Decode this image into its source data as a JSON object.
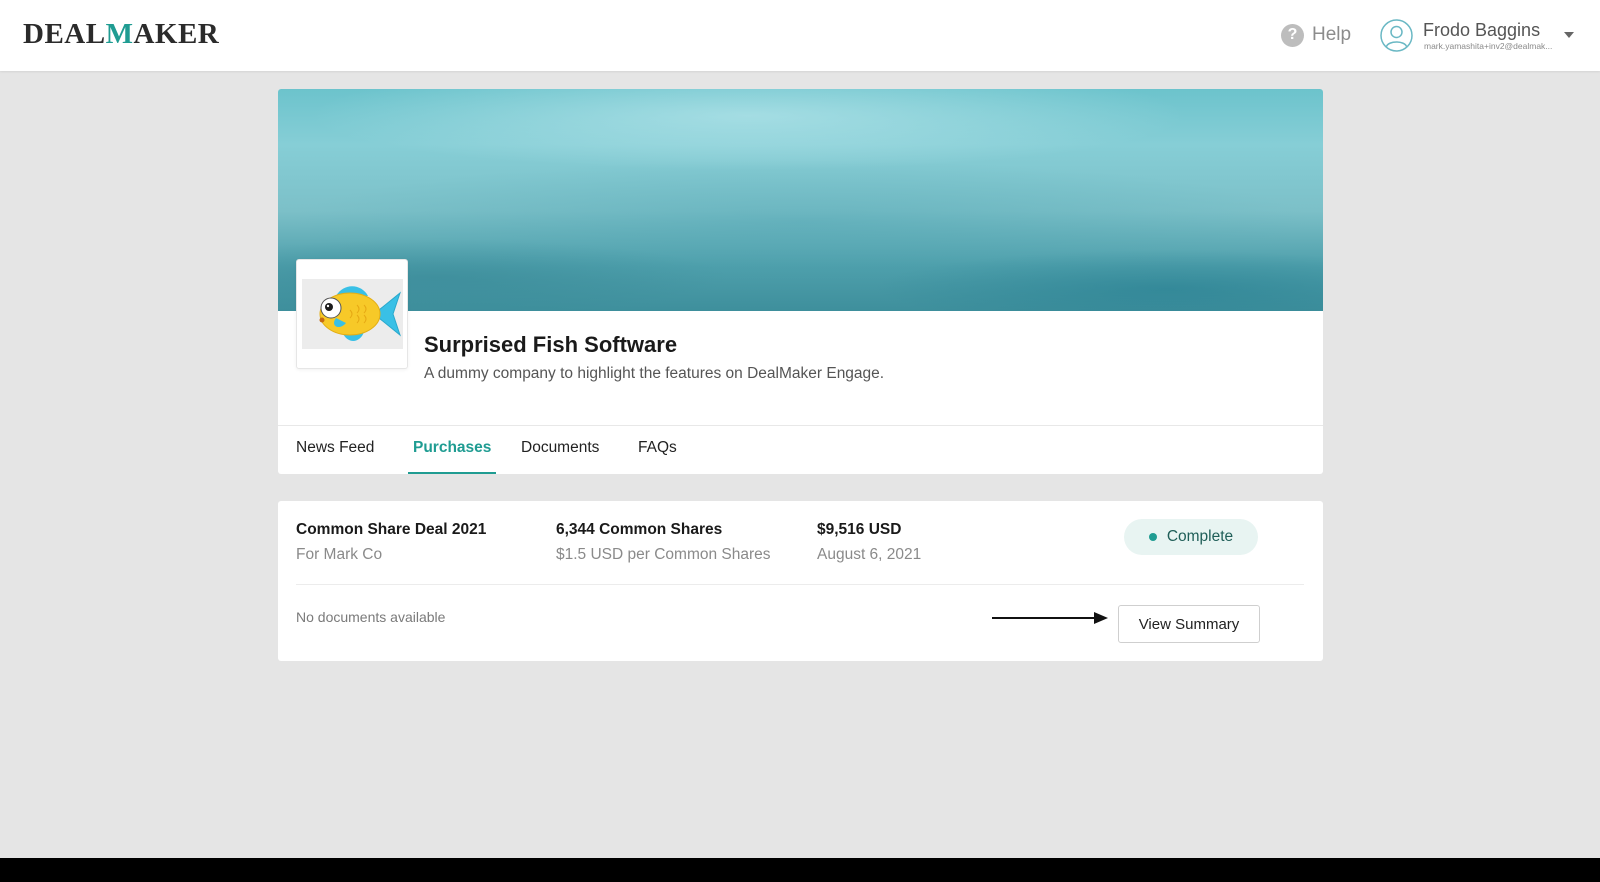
{
  "header": {
    "logo_left": "DEAL",
    "logo_check": "M",
    "logo_right": "AKER",
    "help_label": "Help",
    "user": {
      "name": "Frodo Baggins",
      "email": "mark.yamashita+inv2@dealmak..."
    }
  },
  "company": {
    "name": "Surprised Fish Software",
    "description": "A dummy company to highlight the features on DealMaker Engage."
  },
  "tabs": [
    {
      "label": "News Feed",
      "active": false
    },
    {
      "label": "Purchases",
      "active": true
    },
    {
      "label": "Documents",
      "active": false
    },
    {
      "label": "FAQs",
      "active": false
    }
  ],
  "purchase": {
    "deal_name": "Common Share Deal 2021",
    "deal_for": "For Mark Co",
    "shares": "6,344 Common Shares",
    "price_per_share": "$1.5 USD per Common Shares",
    "amount": "$9,516 USD",
    "date": "August 6, 2021",
    "status": "Complete",
    "documents_text": "No documents available",
    "view_summary_label": "View Summary"
  },
  "colors": {
    "accent": "#1f9c92",
    "status_bg": "#e8f4f2",
    "page_bg": "#e5e5e5"
  },
  "icons": {
    "help": "question-circle-icon",
    "avatar": "user-circle-icon",
    "caret": "chevron-down-icon",
    "company_logo": "fish-logo",
    "arrow": "arrow-right-icon"
  }
}
